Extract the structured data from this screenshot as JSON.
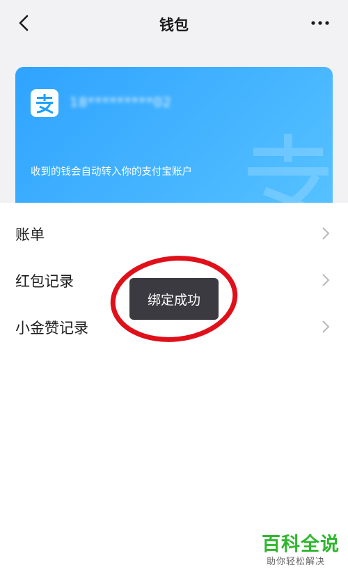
{
  "header": {
    "title": "钱包",
    "back_icon": "chevron-left-icon",
    "more_icon": "more-dots-icon"
  },
  "wallet_card": {
    "logo_icon": "alipay-logo-icon",
    "account": "18*********02",
    "hint": "收到的钱会自动转入你的支付宝账户",
    "gradient_from": "#2fa3ff",
    "gradient_to": "#58c3ff"
  },
  "list": {
    "items": [
      {
        "label": "账单"
      },
      {
        "label": "红包记录"
      },
      {
        "label": "小金赞记录"
      }
    ],
    "chevron_icon": "chevron-right-icon"
  },
  "toast": {
    "message": "绑定成功"
  },
  "annotation": {
    "color": "#e0101a",
    "shape": "ellipse"
  },
  "watermark": {
    "brand": "百科全说",
    "tagline": "助你轻松解决",
    "color": "#2fb72f"
  }
}
